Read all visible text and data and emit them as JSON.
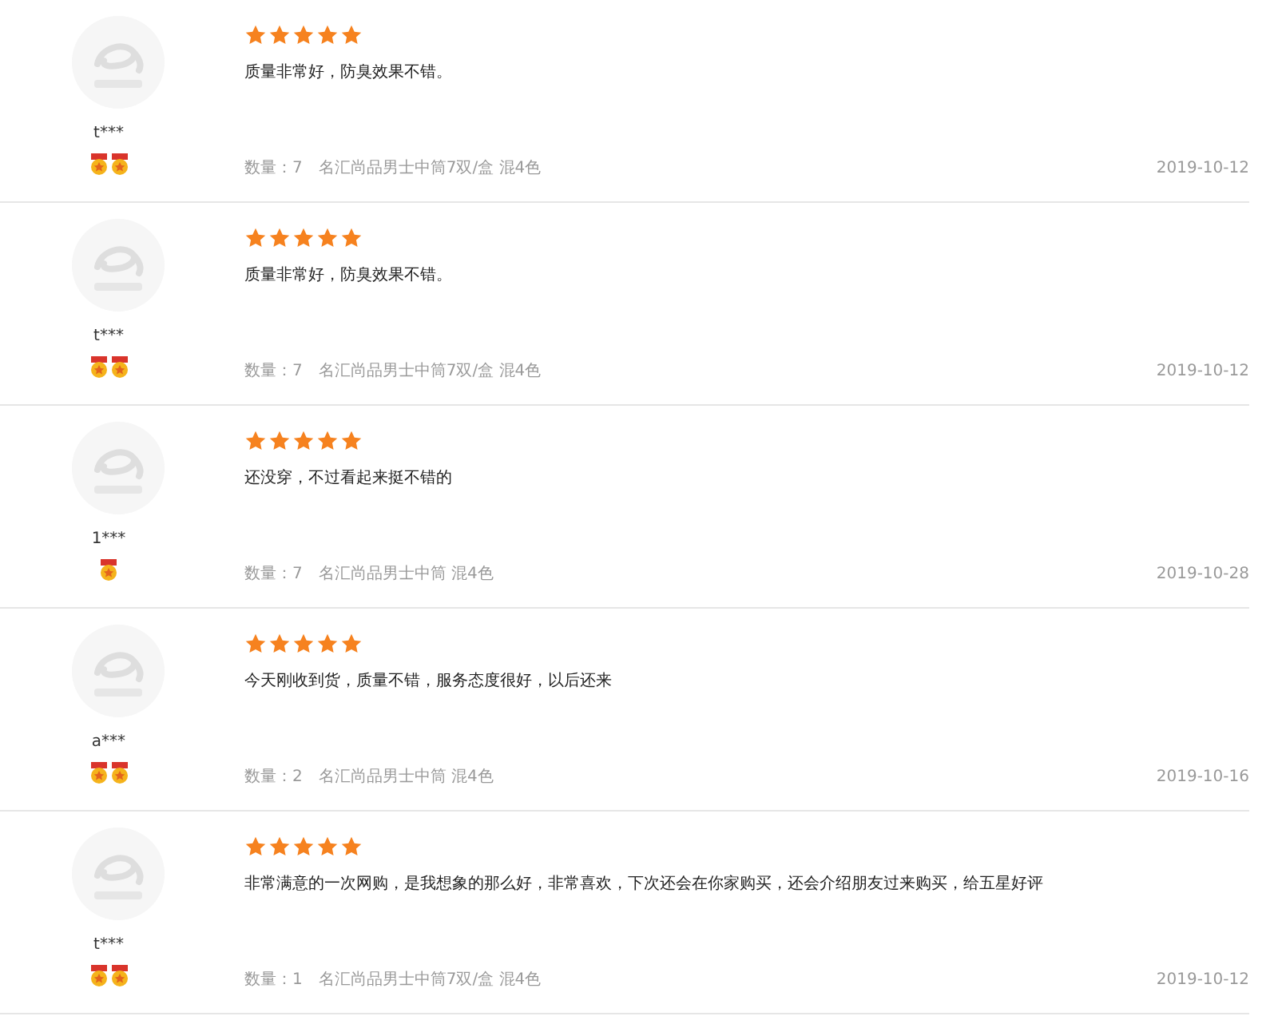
{
  "reviews": [
    {
      "user": "t***",
      "badges": [
        {
          "kind": "medal"
        },
        {
          "kind": "medal"
        }
      ],
      "stars": 5,
      "comment": "质量非常好，防臭效果不错。",
      "quantity": "数量：7",
      "product": "名汇尚品男士中筒7双/盒 混4色",
      "date": "2019-10-12"
    },
    {
      "user": "t***",
      "badges": [
        {
          "kind": "medal"
        },
        {
          "kind": "medal"
        }
      ],
      "stars": 5,
      "comment": "质量非常好，防臭效果不错。",
      "quantity": "数量：7",
      "product": "名汇尚品男士中筒7双/盒 混4色",
      "date": "2019-10-12"
    },
    {
      "user": "1***",
      "badges": [
        {
          "kind": "medal"
        }
      ],
      "stars": 5,
      "comment": "还没穿，不过看起来挺不错的",
      "quantity": "数量：7",
      "product": "名汇尚品男士中筒 混4色",
      "date": "2019-10-28"
    },
    {
      "user": "a***",
      "badges": [
        {
          "kind": "medal"
        },
        {
          "kind": "medal"
        }
      ],
      "stars": 5,
      "comment": "今天刚收到货，质量不错，服务态度很好，以后还来",
      "quantity": "数量：2",
      "product": "名汇尚品男士中筒 混4色",
      "date": "2019-10-16"
    },
    {
      "user": "t***",
      "badges": [
        {
          "kind": "medal"
        },
        {
          "kind": "medal"
        }
      ],
      "stars": 5,
      "comment": "非常满意的一次网购，是我想象的那么好，非常喜欢，下次还会在你家购买，还会介绍朋友过来购买，给五星好评",
      "quantity": "数量：1",
      "product": "名汇尚品男士中筒7双/盒 混4色",
      "date": "2019-10-12"
    }
  ]
}
